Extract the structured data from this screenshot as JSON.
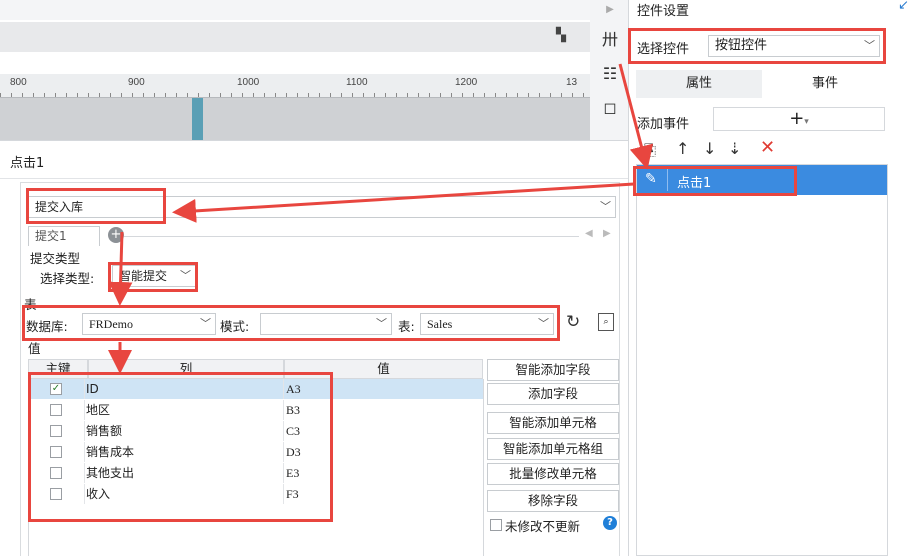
{
  "right_panel": {
    "title": "控件设置",
    "select_label": "选择控件",
    "select_value": "按钮控件",
    "tabs": [
      "属性",
      "事件"
    ],
    "add_event_label": "添加事件",
    "add_symbol": "+",
    "events": [
      "点击1"
    ]
  },
  "ruler": {
    "marks": [
      "800",
      "900",
      "1000",
      "1100",
      "1200",
      "13"
    ]
  },
  "dialog": {
    "title": "点击1",
    "action_value": "提交入库",
    "submit_tab": "提交1",
    "submit_type_section": "提交类型",
    "select_type_label": "选择类型:",
    "select_type_value": "智能提交",
    "table_section": "表",
    "db_label": "数据库:",
    "db_value": "FRDemo",
    "mode_label": "模式:",
    "mode_value": "",
    "table_label": "表:",
    "table_value": "Sales",
    "value_section": "值",
    "grid_headers": [
      "主键",
      "列",
      "值"
    ],
    "rows": [
      {
        "key": true,
        "col": "ID",
        "val": "A3"
      },
      {
        "key": false,
        "col": "地区",
        "val": "B3"
      },
      {
        "key": false,
        "col": "销售额",
        "val": "C3"
      },
      {
        "key": false,
        "col": "销售成本",
        "val": "D3"
      },
      {
        "key": false,
        "col": "其他支出",
        "val": "E3"
      },
      {
        "key": false,
        "col": "收入",
        "val": "F3"
      }
    ],
    "buttons": [
      "智能添加字段",
      "添加字段",
      "智能添加单元格",
      "智能添加单元格组",
      "批量修改单元格",
      "移除字段"
    ],
    "no_update_label": "未修改不更新",
    "help_icon": "?"
  },
  "colors": {
    "accent": "#3b8be0",
    "annotation": "#e8463f"
  }
}
